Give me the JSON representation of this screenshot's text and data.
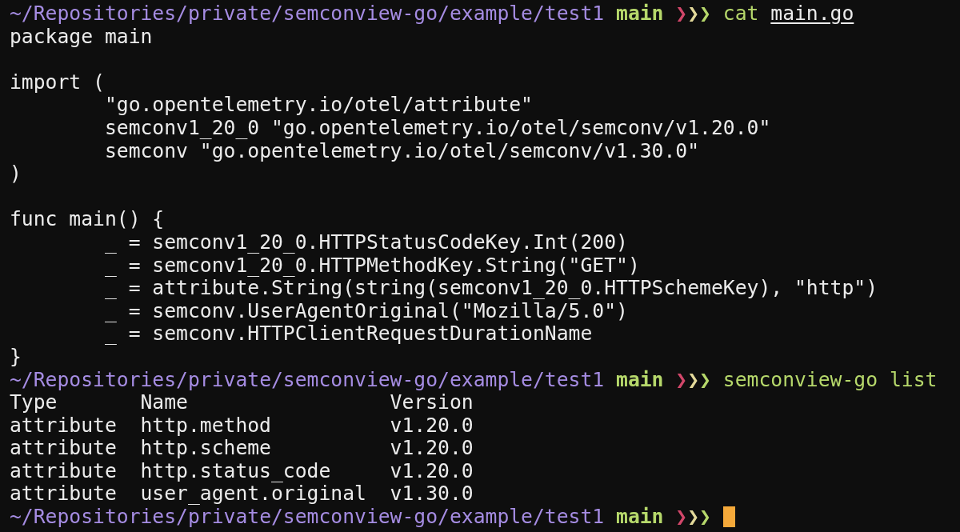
{
  "terminal": {
    "lines": [
      {
        "kind": "prompt",
        "path": "~/Repositories/private/semconview-go/example/test1",
        "branch": "main",
        "chevrons": [
          {
            "char": "❯",
            "color": "#d2476a"
          },
          {
            "char": "❯",
            "color": "#e3d99a"
          },
          {
            "char": "❯",
            "color": "#b6d86b"
          }
        ],
        "command": "cat",
        "argument": "main.go"
      },
      {
        "kind": "output",
        "text": "package main"
      },
      {
        "kind": "output"
      },
      {
        "kind": "output",
        "text": "import ("
      },
      {
        "kind": "output",
        "text": "\t\"go.opentelemetry.io/otel/attribute\""
      },
      {
        "kind": "output",
        "text": "\tsemconv1_20_0 \"go.opentelemetry.io/otel/semconv/v1.20.0\""
      },
      {
        "kind": "output",
        "text": "\tsemconv \"go.opentelemetry.io/otel/semconv/v1.30.0\""
      },
      {
        "kind": "output",
        "text": ")"
      },
      {
        "kind": "output"
      },
      {
        "kind": "output",
        "text": "func main() {"
      },
      {
        "kind": "output",
        "text": "\t_ = semconv1_20_0.HTTPStatusCodeKey.Int(200)"
      },
      {
        "kind": "output",
        "text": "\t_ = semconv1_20_0.HTTPMethodKey.String(\"GET\")"
      },
      {
        "kind": "output",
        "text": "\t_ = attribute.String(string(semconv1_20_0.HTTPSchemeKey), \"http\")"
      },
      {
        "kind": "output",
        "text": "\t_ = semconv.UserAgentOriginal(\"Mozilla/5.0\")"
      },
      {
        "kind": "output",
        "text": "\t_ = semconv.HTTPClientRequestDurationName"
      },
      {
        "kind": "output",
        "text": "}"
      },
      {
        "kind": "prompt",
        "path": "~/Repositories/private/semconview-go/example/test1",
        "branch": "main",
        "chevrons": [
          {
            "char": "❯",
            "color": "#d2476a"
          },
          {
            "char": "❯",
            "color": "#e3d99a"
          },
          {
            "char": "❯",
            "color": "#b6d86b"
          }
        ],
        "command": "semconview-go list"
      },
      {
        "kind": "table",
        "columns": [
          "Type",
          "Name",
          "Version"
        ],
        "rows": [
          [
            "attribute",
            "http.method",
            "v1.20.0"
          ],
          [
            "attribute",
            "http.scheme",
            "v1.20.0"
          ],
          [
            "attribute",
            "http.status_code",
            "v1.20.0"
          ],
          [
            "attribute",
            "user_agent.original",
            "v1.30.0"
          ]
        ]
      },
      {
        "kind": "prompt",
        "path": "~/Repositories/private/semconview-go/example/test1",
        "branch": "main",
        "chevrons": [
          {
            "char": "❯",
            "color": "#d2476a"
          },
          {
            "char": "❯",
            "color": "#e3d99a"
          },
          {
            "char": "❯",
            "color": "#b6d86b"
          }
        ],
        "cursor": true
      }
    ]
  }
}
